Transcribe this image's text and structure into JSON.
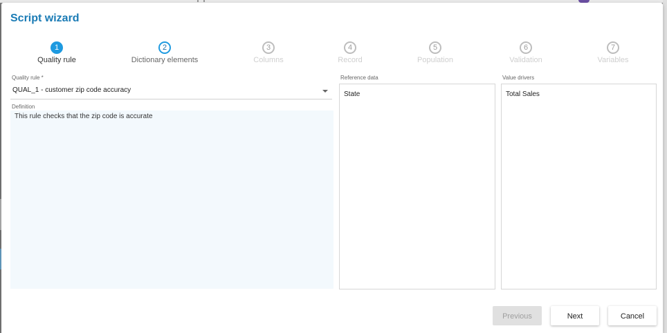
{
  "dialog": {
    "title": "Script wizard"
  },
  "steps": [
    {
      "number": "1",
      "label": "Quality rule",
      "state": "active"
    },
    {
      "number": "2",
      "label": "Dictionary elements",
      "state": "visited"
    },
    {
      "number": "3",
      "label": "Columns",
      "state": "pending"
    },
    {
      "number": "4",
      "label": "Record",
      "state": "pending"
    },
    {
      "number": "5",
      "label": "Population",
      "state": "pending"
    },
    {
      "number": "6",
      "label": "Validation",
      "state": "pending"
    },
    {
      "number": "7",
      "label": "Variables",
      "state": "pending"
    }
  ],
  "form": {
    "quality_rule": {
      "label": "Quality rule *",
      "value": "QUAL_1 - customer zip code accuracy"
    },
    "definition": {
      "label": "Definition",
      "value": "This rule checks that the zip code is accurate"
    },
    "reference_data": {
      "label": "Reference data",
      "items": [
        "State"
      ]
    },
    "value_drivers": {
      "label": "Value drivers",
      "items": [
        "Total Sales"
      ]
    }
  },
  "buttons": {
    "previous": "Previous",
    "next": "Next",
    "cancel": "Cancel"
  },
  "colors": {
    "accent": "#1e9ae0",
    "title": "#1a7bb5",
    "definition_bg": "#f3f9fd"
  }
}
